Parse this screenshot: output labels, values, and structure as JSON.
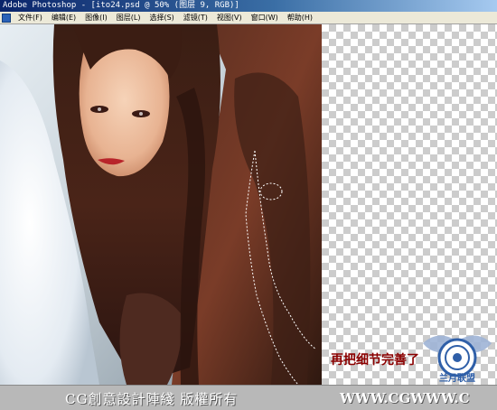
{
  "window": {
    "title": "Adobe Photoshop - [ito24.psd @ 50% (图层 9, RGB)]"
  },
  "menu": {
    "items": [
      {
        "label": "文件(F)"
      },
      {
        "label": "编辑(E)"
      },
      {
        "label": "图像(I)"
      },
      {
        "label": "图层(L)"
      },
      {
        "label": "选择(S)"
      },
      {
        "label": "滤镜(T)"
      },
      {
        "label": "视图(V)"
      },
      {
        "label": "窗口(W)"
      },
      {
        "label": "帮助(H)"
      }
    ]
  },
  "canvas": {
    "caption": "再把细节完善了"
  },
  "footer": {
    "left_text": "CG創意設計陣綫 版權所有",
    "right_text": "WWW.CGWWW.C"
  },
  "badge": {
    "text": "兰月联盟",
    "url": "www.lanyue.com"
  },
  "colors": {
    "titlebar": "#0a246a",
    "menubar": "#ece9d8",
    "caption": "#8b0000"
  }
}
